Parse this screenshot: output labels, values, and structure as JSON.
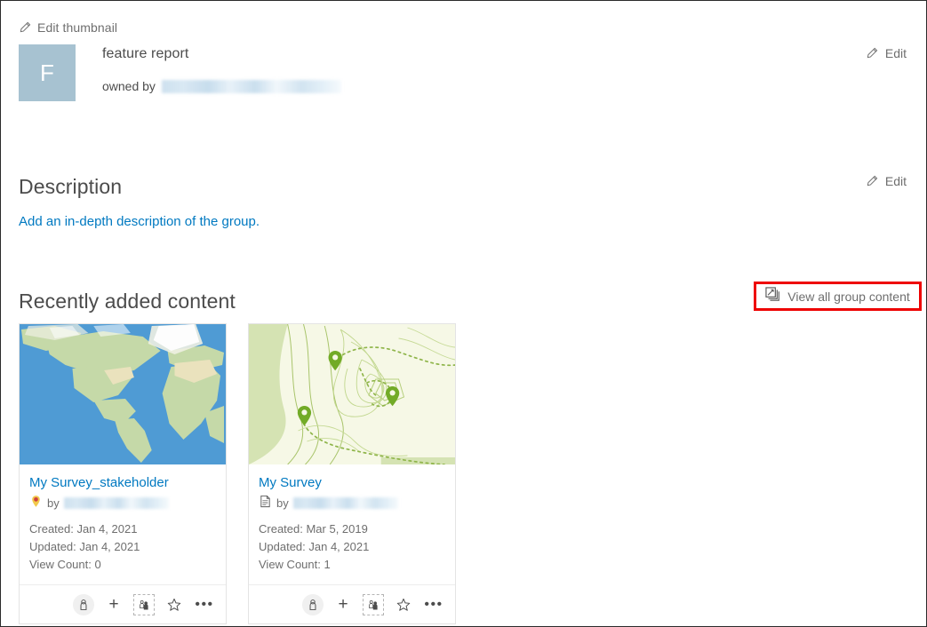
{
  "header": {
    "edit_thumbnail_label": "Edit thumbnail",
    "thumbnail_letter": "F",
    "thumbnail_color": "#a7c2d1",
    "group_title": "feature report",
    "owned_by_label": "owned by",
    "owner_name": "",
    "edit_label": "Edit"
  },
  "description": {
    "title": "Description",
    "edit_label": "Edit",
    "add_description_link": "Add an in-depth description of the group."
  },
  "recent": {
    "title": "Recently added content",
    "view_all_label": "View all group content",
    "highlight_color": "#ee0000"
  },
  "link_color": "#0079c1",
  "cards": [
    {
      "name": "My Survey_stakeholder",
      "thumbnail": "world-map",
      "type_icon": "survey-pin-icon",
      "by_label": "by",
      "author": "",
      "created_label": "Created: Jan 4, 2021",
      "updated_label": "Updated: Jan 4, 2021",
      "view_count_label": "View Count: 0",
      "actions": [
        {
          "name": "share-private-icon",
          "glyph": "person"
        },
        {
          "name": "add-item-icon",
          "glyph": "plus"
        },
        {
          "name": "share-group-icon",
          "glyph": "group"
        },
        {
          "name": "favorite-star-icon",
          "glyph": "star"
        },
        {
          "name": "more-options-icon",
          "glyph": "dots"
        }
      ]
    },
    {
      "name": "My Survey",
      "thumbnail": "topo-map",
      "type_icon": "form-document-icon",
      "by_label": "by",
      "author": "",
      "created_label": "Created: Mar 5, 2019",
      "updated_label": "Updated: Jan 4, 2021",
      "view_count_label": "View Count: 1",
      "actions": [
        {
          "name": "share-private-icon",
          "glyph": "person"
        },
        {
          "name": "add-item-icon",
          "glyph": "plus"
        },
        {
          "name": "share-group-icon",
          "glyph": "group"
        },
        {
          "name": "favorite-star-icon",
          "glyph": "star"
        },
        {
          "name": "more-options-icon",
          "glyph": "dots"
        }
      ]
    }
  ]
}
